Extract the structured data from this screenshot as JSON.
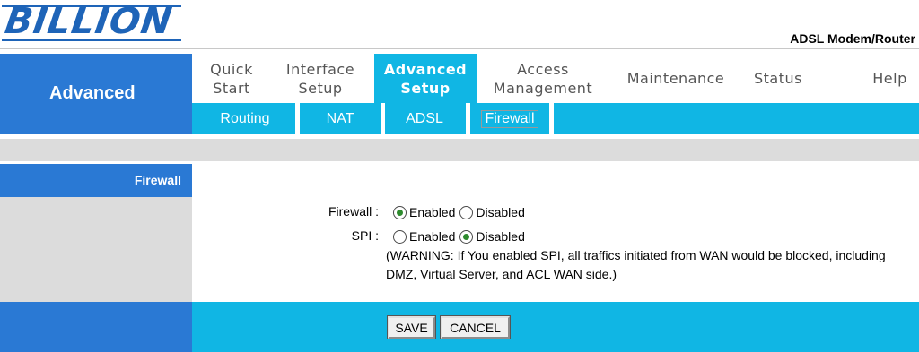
{
  "brand": {
    "logo_text": "BILLION",
    "product": "ADSL Modem/Router"
  },
  "section_title": "Advanced",
  "main_tabs": [
    {
      "label": "Quick\nStart"
    },
    {
      "label": "Interface\nSetup"
    },
    {
      "label": "Advanced\nSetup"
    },
    {
      "label": "Access\nManagement"
    },
    {
      "label": "Maintenance"
    },
    {
      "label": "Status"
    },
    {
      "label": "Help"
    }
  ],
  "sub_tabs": [
    {
      "label": "Routing"
    },
    {
      "label": "NAT"
    },
    {
      "label": "ADSL"
    },
    {
      "label": "Firewall"
    }
  ],
  "page": {
    "left_title": "Firewall",
    "firewall": {
      "label": "Firewall :",
      "enabled": "Enabled",
      "disabled": "Disabled",
      "selected": "Enabled"
    },
    "spi": {
      "label": "SPI :",
      "enabled": "Enabled",
      "disabled": "Disabled",
      "selected": "Disabled"
    },
    "warning": "(WARNING: If You enabled SPI, all traffics initiated from WAN would be blocked, including DMZ, Virtual Server, and ACL WAN side.)"
  },
  "buttons": {
    "save": "SAVE",
    "cancel": "CANCEL"
  },
  "colors": {
    "nav_blue": "#2a79d4",
    "cyan": "#10b6e4",
    "grey": "#dcdcdc"
  }
}
